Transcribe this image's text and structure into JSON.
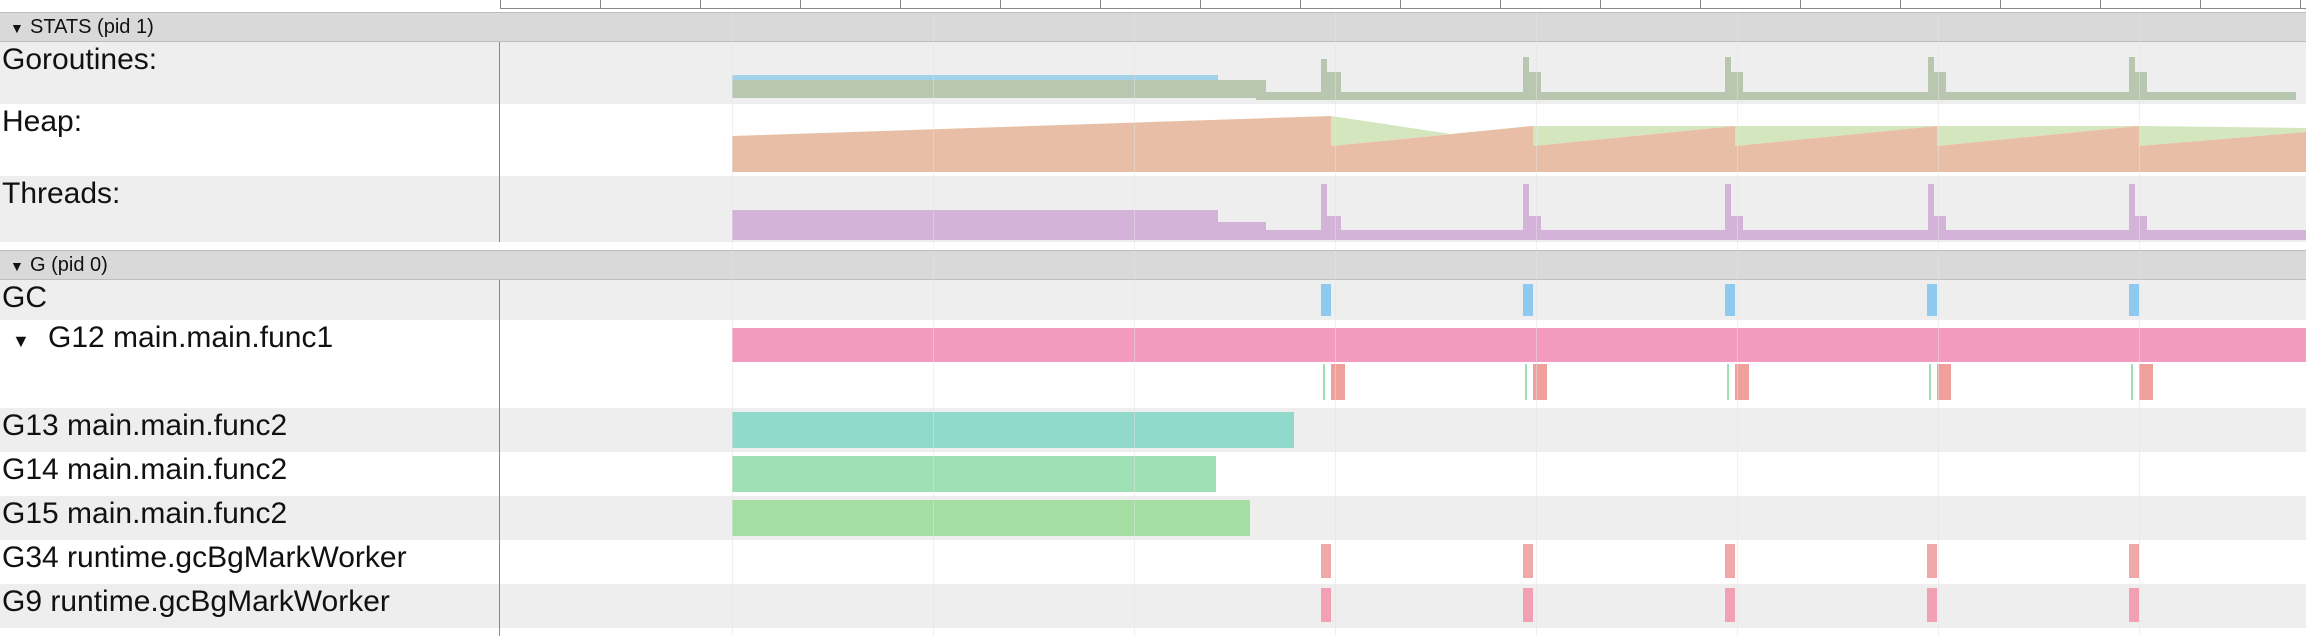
{
  "processes": [
    {
      "name": "STATS (pid 1)",
      "expanded": true
    },
    {
      "name": "G (pid 0)",
      "expanded": true
    }
  ],
  "stats_tracks": [
    {
      "label": "Goroutines:",
      "color": "#b9c7b0",
      "accent": "#8fcbe8"
    },
    {
      "label": "Heap:",
      "color": "#e8bfa6",
      "accent": "#d4e6bd"
    },
    {
      "label": "Threads:",
      "color": "#d4b3d8"
    }
  ],
  "g_tracks": [
    {
      "label": "GC",
      "color": "#8ec9f0"
    },
    {
      "label": "G12 main.main.func1",
      "color": "#f29ac0",
      "sub_color": "#f0a09a",
      "expandable": true
    },
    {
      "label": "G13 main.main.func2",
      "color": "#91d9cb"
    },
    {
      "label": "G14 main.main.func2",
      "color": "#9fe0b4"
    },
    {
      "label": "G15 main.main.func2",
      "color": "#a4dea2"
    },
    {
      "label": "G34 runtime.gcBgMarkWorker",
      "color": "#f0a8a8"
    },
    {
      "label": "G9 runtime.gcBgMarkWorker",
      "color": "#f2a0b4"
    }
  ],
  "gc_cycles": 5
}
